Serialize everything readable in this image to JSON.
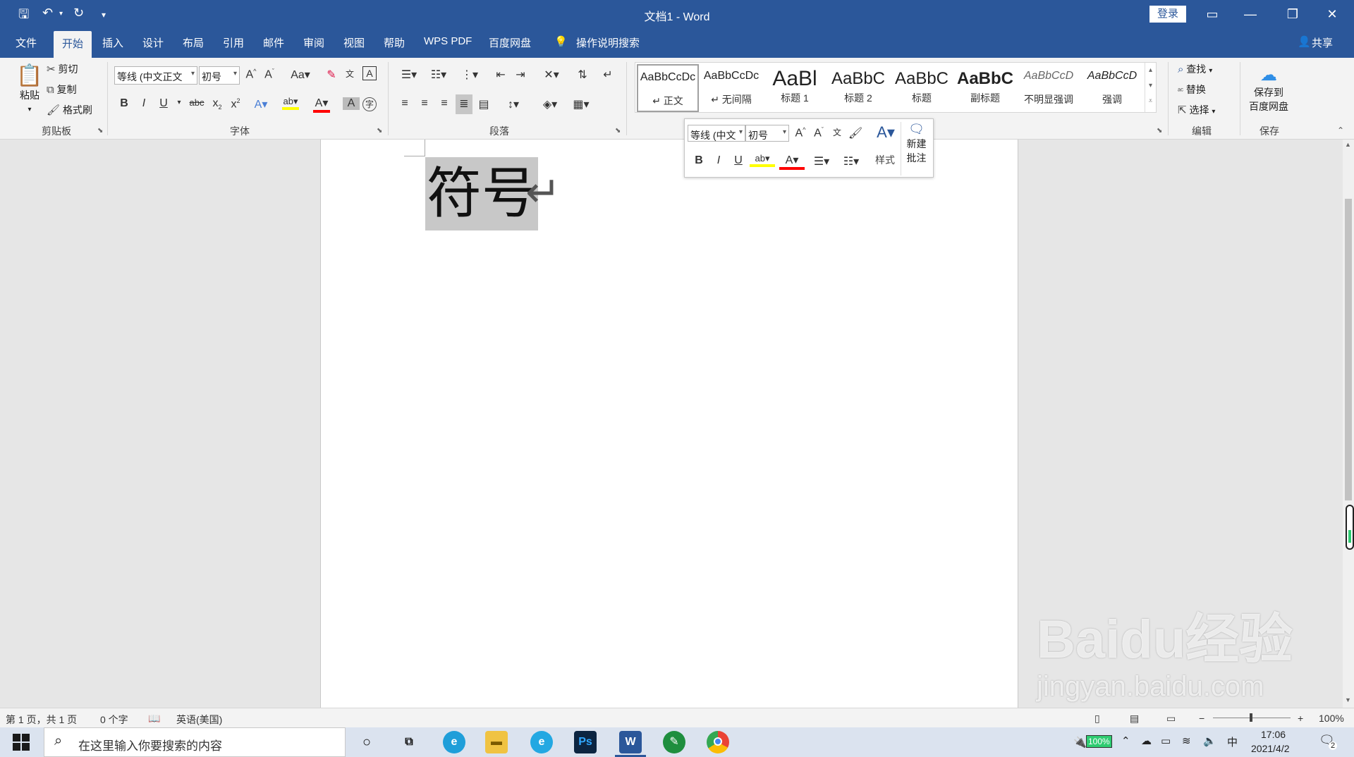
{
  "window": {
    "title": "文档1  -  Word",
    "login_label": "登录"
  },
  "tabs": [
    "文件",
    "开始",
    "插入",
    "设计",
    "布局",
    "引用",
    "邮件",
    "审阅",
    "视图",
    "帮助",
    "WPS PDF",
    "百度网盘"
  ],
  "tell_me": "操作说明搜索",
  "share_label": "共享",
  "clipboard": {
    "paste": "粘贴",
    "cut": "剪切",
    "copy": "复制",
    "format_painter": "格式刷",
    "group_label": "剪贴板"
  },
  "font": {
    "name": "等线 (中文正文",
    "size": "初号",
    "group_label": "字体"
  },
  "paragraph": {
    "group_label": "段落"
  },
  "styles": {
    "items": [
      {
        "sample": "AaBbCcDc",
        "name": "↵ 正文"
      },
      {
        "sample": "AaBbCcDc",
        "name": "↵ 无间隔"
      },
      {
        "sample": "AaBl",
        "name": "标题 1"
      },
      {
        "sample": "AaBbC",
        "name": "标题 2"
      },
      {
        "sample": "AaBbC",
        "name": "标题"
      },
      {
        "sample": "AaBbC",
        "name": "副标题"
      },
      {
        "sample": "AaBbCcD",
        "name": "不明显强调"
      },
      {
        "sample": "AaBbCcD",
        "name": "强调"
      }
    ]
  },
  "editing": {
    "find": "查找",
    "replace": "替换",
    "select": "选择",
    "group_label": "编辑"
  },
  "save_group": {
    "button": "保存到\n百度网盘",
    "line1": "保存到",
    "line2": "百度网盘",
    "group_label": "保存"
  },
  "minibar": {
    "font": "等线 (中文",
    "size": "初号",
    "styles_label": "样式",
    "comment_line1": "新建",
    "comment_line2": "批注"
  },
  "document": {
    "text": "符号",
    "para_mark": "↵"
  },
  "status": {
    "page": "第 1 页，共 1 页",
    "words": "0 个字",
    "language": "英语(美国)",
    "zoom": "100%"
  },
  "taskbar": {
    "search_placeholder": "在这里输入你要搜索的内容",
    "battery": "100%",
    "ime": "中",
    "time": "17:06",
    "date": "2021/4/2",
    "notifications": "2"
  },
  "watermark": {
    "brand": "Baidu经验",
    "url": "jingyan.baidu.com"
  },
  "colors": {
    "accent": "#2b579a",
    "highlight": "#ffff00",
    "font_color": "#ff0000"
  }
}
